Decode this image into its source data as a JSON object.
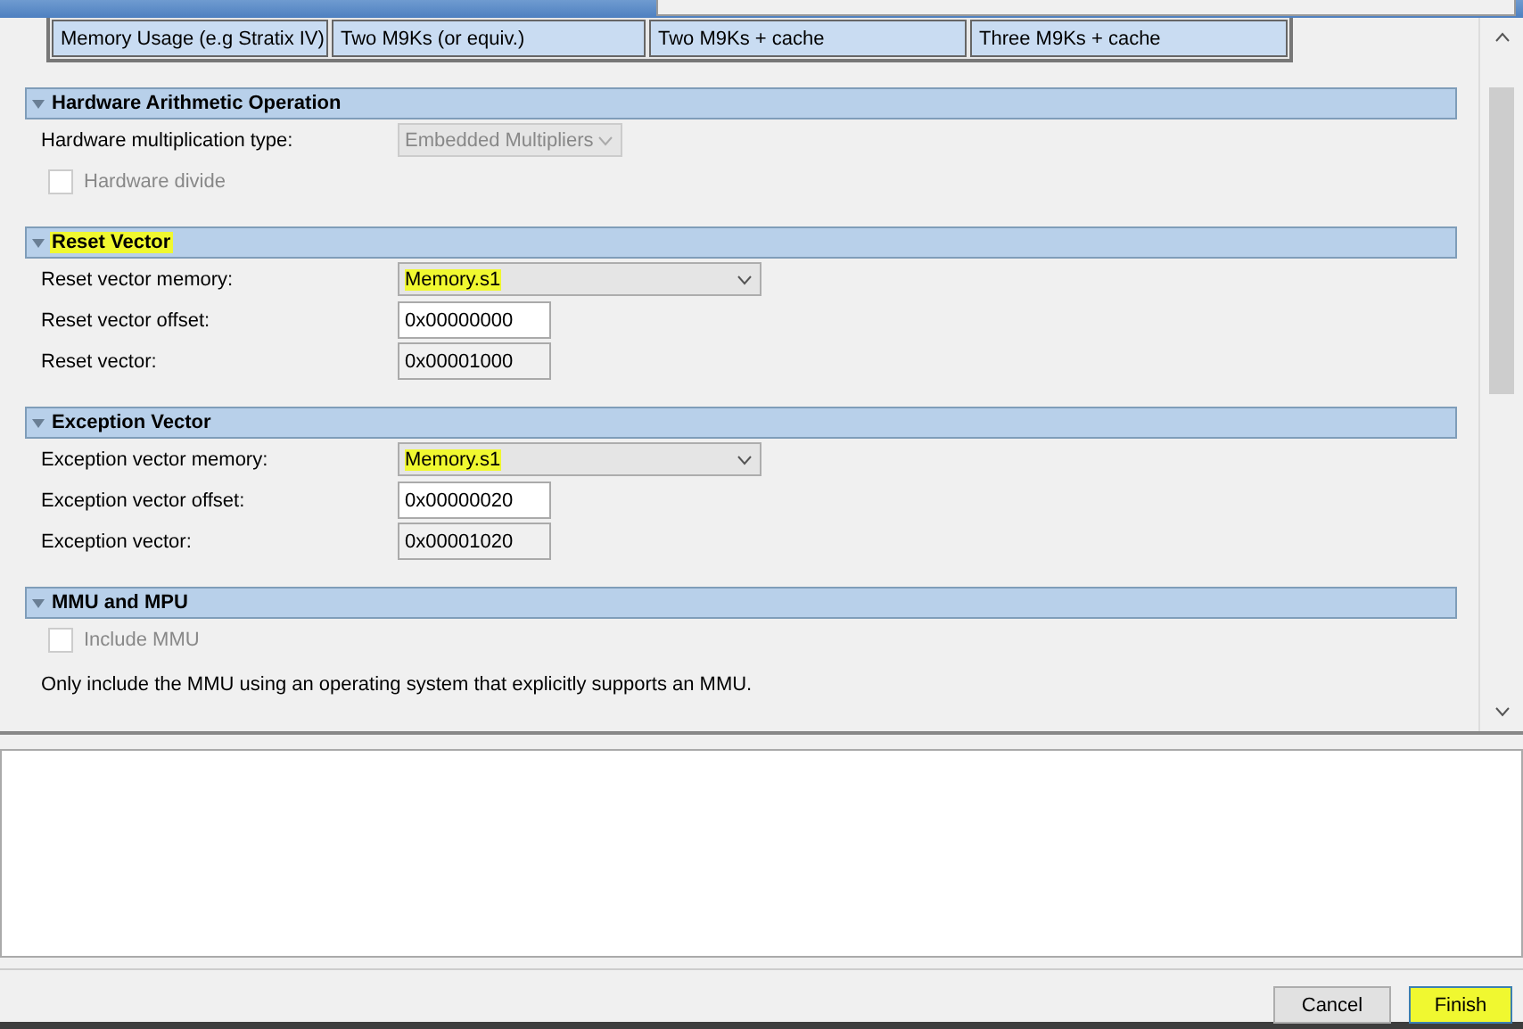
{
  "memory_table": {
    "cells": [
      "Memory Usage (e.g Stratix IV)",
      "Two M9Ks (or equiv.)",
      "Two M9Ks + cache",
      "Three M9Ks + cache"
    ]
  },
  "sections": [
    {
      "title": "Hardware Arithmetic Operation",
      "highlighted": false,
      "rows": [
        {
          "kind": "combo",
          "label": "Hardware multiplication type:",
          "value": "Embedded Multipliers",
          "disabled": true,
          "highlighted": false
        },
        {
          "kind": "checkbox",
          "label": "Hardware divide",
          "checked": false,
          "disabled": true
        }
      ]
    },
    {
      "title": "Reset Vector",
      "highlighted": true,
      "rows": [
        {
          "kind": "combo",
          "label": "Reset vector memory:",
          "value": "Memory.s1",
          "disabled": false,
          "highlighted": true
        },
        {
          "kind": "field",
          "label": "Reset vector offset:",
          "value": "0x00000000",
          "disabled": false
        },
        {
          "kind": "field",
          "label": "Reset vector:",
          "value": "0x00001000",
          "disabled": true
        }
      ]
    },
    {
      "title": "Exception Vector",
      "highlighted": false,
      "rows": [
        {
          "kind": "combo",
          "label": "Exception vector memory:",
          "value": "Memory.s1",
          "disabled": false,
          "highlighted": true
        },
        {
          "kind": "field",
          "label": "Exception vector offset:",
          "value": "0x00000020",
          "disabled": false
        },
        {
          "kind": "field",
          "label": "Exception vector:",
          "value": "0x00001020",
          "disabled": true
        }
      ]
    },
    {
      "title": "MMU and MPU",
      "highlighted": false,
      "rows": [
        {
          "kind": "checkbox",
          "label": "Include MMU",
          "checked": false,
          "disabled": true
        },
        {
          "kind": "text",
          "label": "Only include the MMU using an operating system that explicitly supports an MMU."
        }
      ]
    }
  ],
  "buttons": [
    {
      "label": "Cancel",
      "highlighted": false
    },
    {
      "label": "Finish",
      "highlighted": true
    }
  ]
}
